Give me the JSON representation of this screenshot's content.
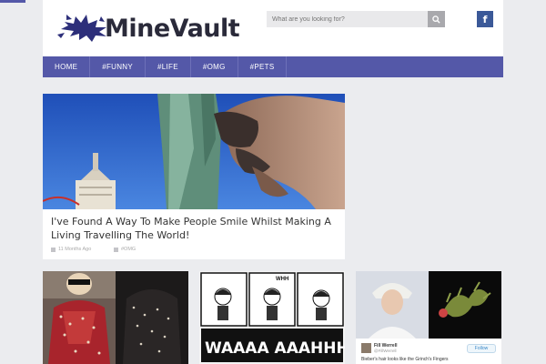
{
  "header": {
    "logo_text": "MineVault",
    "search_placeholder": "What are you looking for?",
    "search_icon": "search-icon",
    "facebook_label": "f"
  },
  "nav": {
    "items": [
      {
        "label": "HOME"
      },
      {
        "label": "#FUNNY"
      },
      {
        "label": "#LIFE"
      },
      {
        "label": "#OMG"
      },
      {
        "label": "#PETS"
      }
    ]
  },
  "main_post": {
    "title": "I've Found A Way To Make People Smile Whilst Making A Living Travelling The World!",
    "date": "11 Months Ago",
    "tag": "#OMG"
  },
  "tweet": {
    "name": "Fill Werrell",
    "handle": "@FillWerrell",
    "follow_label": "Follow",
    "text": "Bieber's hair looks like the Grinch's Fingers"
  },
  "comic": {
    "text_top": "WHH",
    "text_bottom": "WAAAA AAAHHH"
  },
  "colors": {
    "nav": "#5458a8",
    "facebook": "#3b5998",
    "background": "#ebecef"
  }
}
